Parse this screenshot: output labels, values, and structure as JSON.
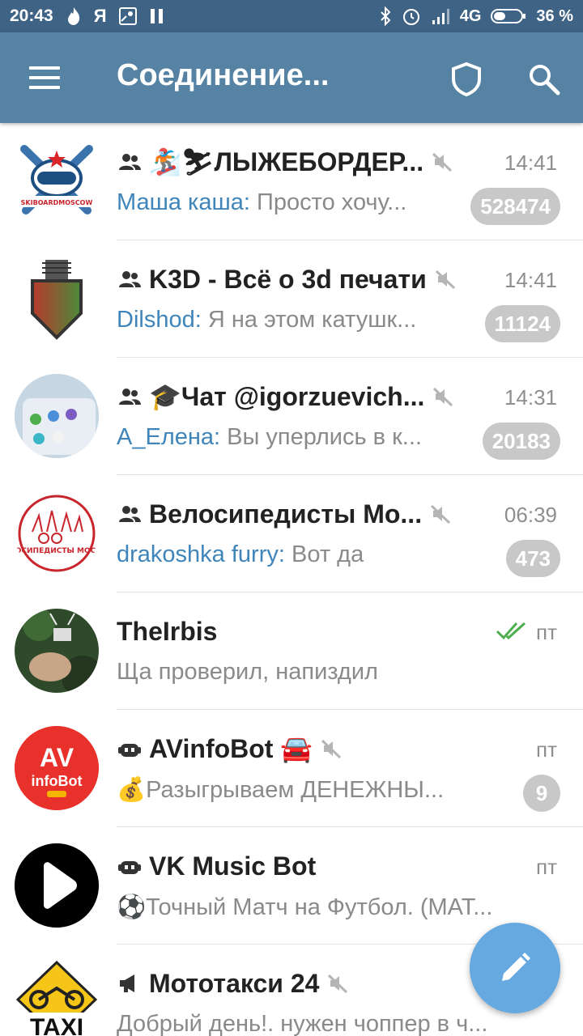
{
  "status_bar": {
    "time": "20:43",
    "network": "4G",
    "battery": "36 %"
  },
  "app_bar": {
    "title": "Соединение..."
  },
  "colors": {
    "header": "#5682a3",
    "status_bar": "#3f6385",
    "sender": "#3f85ba",
    "badge": "#c8c8c8",
    "fab": "#65a9e0",
    "read_check": "#4cae4c"
  },
  "chats": [
    {
      "title": "🏂⛷ЛЫЖЕБОРДЕР...",
      "kind": "group",
      "muted": true,
      "time": "14:41",
      "sender": "Маша каша:",
      "message": " Просто хочу...",
      "unread": "528474",
      "avatar_text": "SKIBOARDMOSCOW"
    },
    {
      "title": "K3D - Всё о 3d печати",
      "kind": "group",
      "muted": true,
      "time": "14:41",
      "sender": "Dilshod:",
      "message": " Я на этом катушк...",
      "unread": "11124"
    },
    {
      "title": "🎓Чат @igorzuevich...",
      "kind": "group",
      "muted": true,
      "time": "14:31",
      "sender": "A_Елена:",
      "message": " Вы уперлись в к...",
      "unread": "20183"
    },
    {
      "title": "Велосипедисты Мо...",
      "kind": "group",
      "muted": true,
      "time": "06:39",
      "sender": "drakoshka furry:",
      "message": " Вот да",
      "unread": "473",
      "avatar_text": "ВЕЛОСИПЕДИСТЫ МОСКВЫ"
    },
    {
      "title": "TheIrbis",
      "kind": "user",
      "muted": false,
      "time": "пт",
      "sender": "",
      "message": "Ща проверил, напиздил",
      "unread": ""
    },
    {
      "title": "AVinfoBot 🚘",
      "kind": "bot",
      "muted": true,
      "time": "пт",
      "sender": "",
      "message": "💰Разыгрываем ДЕНЕЖНЫ...",
      "unread": "9",
      "avatar_text": "AV infoBot"
    },
    {
      "title": "VK Music Bot",
      "kind": "bot",
      "muted": false,
      "time": "пт",
      "sender": "",
      "message": "⚽Точный Матч на Футбол. (МАТ...",
      "unread": ""
    },
    {
      "title": "Мототакси 24",
      "kind": "channel",
      "muted": true,
      "time": "",
      "sender": "",
      "message": "Добрый день!. нужен чоппер в ч...",
      "unread": "",
      "avatar_text": "TAXI"
    }
  ]
}
